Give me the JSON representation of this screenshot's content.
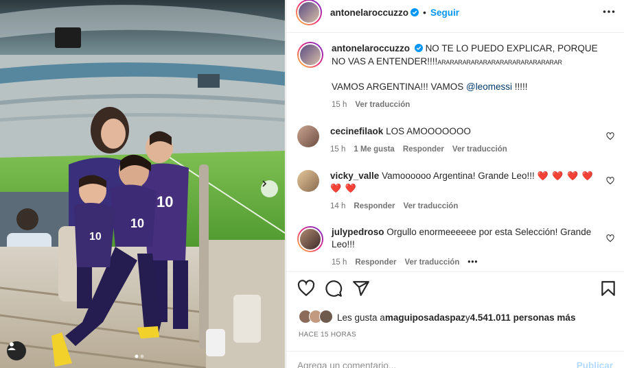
{
  "post": {
    "author": "antonelaroccuzzo",
    "follow_label": "Seguir",
    "separator": "•",
    "caption_line1": "NO TE LO PUEDO EXPLICAR, PORQUE NO VAS A ENTENDER!!!!",
    "caption_tail": "ARARARARARARARARARARARARARARAR",
    "caption_line2": "VAMOS ARGENTINA!!! VAMOS ",
    "caption_mention": "@leomessi",
    "caption_line2_end": " !!!!!",
    "caption_time": "15 h",
    "translate_label": "Ver traducción"
  },
  "comments": [
    {
      "user": "cecinefilaok",
      "text": "LOS AMOOOOOOO",
      "time": "15 h",
      "likes": "1 Me gusta",
      "reply": "Responder",
      "translate": "Ver traducción"
    },
    {
      "user": "vicky_valle",
      "text": "Vamoooooo Argentina! Grande Leo!!!",
      "hearts_line1": "❤️ ❤️ ❤️ ❤️",
      "hearts_line2": "❤️ ❤️",
      "time": "14 h",
      "reply": "Responder",
      "translate": "Ver traducción"
    },
    {
      "user": "julypedroso",
      "text": "Orgullo enormeeeeee por esta Selección! Grande Leo!!!",
      "time": "15 h",
      "reply": "Responder",
      "translate": "Ver traducción",
      "more": "•••"
    }
  ],
  "likes": {
    "prefix": "Les gusta a ",
    "user": "maguiposadaspaz",
    "middle": " y ",
    "count": "4.541.011 personas más"
  },
  "posted_ago": "HACE 15 HORAS",
  "add_comment": {
    "placeholder": "Agrega un comentario...",
    "post_label": "Publicar"
  },
  "icons": {
    "more": "more-horizontal-icon",
    "like": "heart-icon",
    "comment": "comment-icon",
    "share": "send-icon",
    "save": "bookmark-icon",
    "next": "chevron-right-icon",
    "tag": "user-tag-icon"
  },
  "colors": {
    "accent": "#0095f6",
    "verified": "#0095f6",
    "mention": "#00376b",
    "muted": "#737373"
  }
}
